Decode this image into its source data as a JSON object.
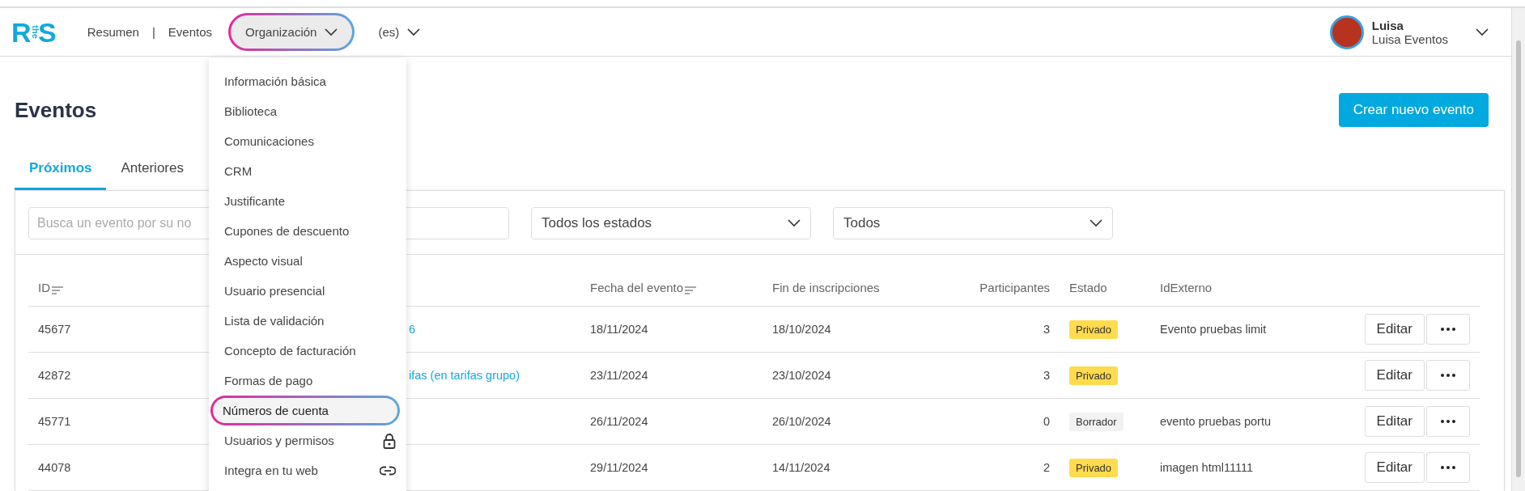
{
  "header": {
    "logo": {
      "first": "R",
      "middle": "the",
      "last": "S"
    },
    "nav": [
      {
        "kind": "link",
        "label": "Resumen"
      },
      {
        "kind": "separator",
        "label": "|"
      },
      {
        "kind": "link",
        "label": "Eventos"
      },
      {
        "kind": "dropdown",
        "label": "Organización",
        "expanded": true,
        "highlighted": true
      },
      {
        "kind": "dropdown",
        "label": "(es)",
        "expanded": false,
        "highlighted": false
      }
    ],
    "user": {
      "name": "Luisa",
      "organization": "Luisa Eventos"
    }
  },
  "page": {
    "title": "Eventos",
    "create_button": "Crear nuevo evento"
  },
  "tabs": [
    {
      "label": "Próximos",
      "selected": true
    },
    {
      "label": "Anteriores",
      "selected": false
    }
  ],
  "filters": {
    "search": {
      "placeholder": "Busca un evento por su no"
    },
    "status": "Todos los estados",
    "type": "Todos"
  },
  "table": {
    "columns": [
      {
        "label": "ID",
        "sortable": true
      },
      {
        "label": "Fecha del evento",
        "sortable": true
      },
      {
        "label": "Fin de inscripciones",
        "sortable": false
      },
      {
        "label": "Participantes",
        "sortable": false
      },
      {
        "label": "Estado",
        "sortable": false
      },
      {
        "label": "IdExterno",
        "sortable": false
      }
    ],
    "rows": [
      {
        "id": "45677",
        "name": "6",
        "event_date": "18/11/2024",
        "registration_end": "18/10/2024",
        "participants": "3",
        "status": {
          "label": "Privado",
          "kind": "private"
        },
        "external_id": "Evento pruebas limit",
        "edit": "Editar"
      },
      {
        "id": "42872",
        "name": "ifas (en tarifas grupo)",
        "event_date": "23/11/2024",
        "registration_end": "23/10/2024",
        "participants": "3",
        "status": {
          "label": "Privado",
          "kind": "private"
        },
        "edit": "Editar"
      },
      {
        "id": "45771",
        "event_date": "26/11/2024",
        "registration_end": "26/10/2024",
        "participants": "0",
        "status": {
          "label": "Borrador",
          "kind": "draft"
        },
        "external_id": "evento pruebas portu",
        "edit": "Editar"
      },
      {
        "id": "44078",
        "event_date": "29/11/2024",
        "registration_end": "14/11/2024",
        "participants": "2",
        "status": {
          "label": "Privado",
          "kind": "private"
        },
        "external_id": "imagen html11111",
        "edit": "Editar"
      }
    ]
  },
  "menu": {
    "items": [
      {
        "label": "Información básica",
        "selected": false,
        "highlighted": false
      },
      {
        "label": "Biblioteca",
        "selected": false,
        "highlighted": false
      },
      {
        "label": "Comunicaciones",
        "selected": false,
        "highlighted": false
      },
      {
        "label": "CRM",
        "selected": false,
        "highlighted": false
      },
      {
        "label": "Justificante",
        "selected": false,
        "highlighted": false
      },
      {
        "label": "Cupones de descuento",
        "selected": false,
        "highlighted": false
      },
      {
        "label": "Aspecto visual",
        "selected": false,
        "highlighted": false
      },
      {
        "label": "Usuario presencial",
        "selected": false,
        "highlighted": false
      },
      {
        "label": "Lista de validación",
        "selected": false,
        "highlighted": false
      },
      {
        "label": "Concepto de facturación",
        "selected": false,
        "highlighted": false
      },
      {
        "label": "Formas de pago",
        "selected": false,
        "highlighted": false
      },
      {
        "label": "Números de cuenta",
        "selected": true,
        "highlighted": true
      },
      {
        "label": "Usuarios y permisos",
        "selected": false,
        "highlighted": false,
        "kind": "lock"
      },
      {
        "label": "Integra en tu web",
        "selected": false,
        "highlighted": false,
        "kind": "link"
      }
    ]
  }
}
